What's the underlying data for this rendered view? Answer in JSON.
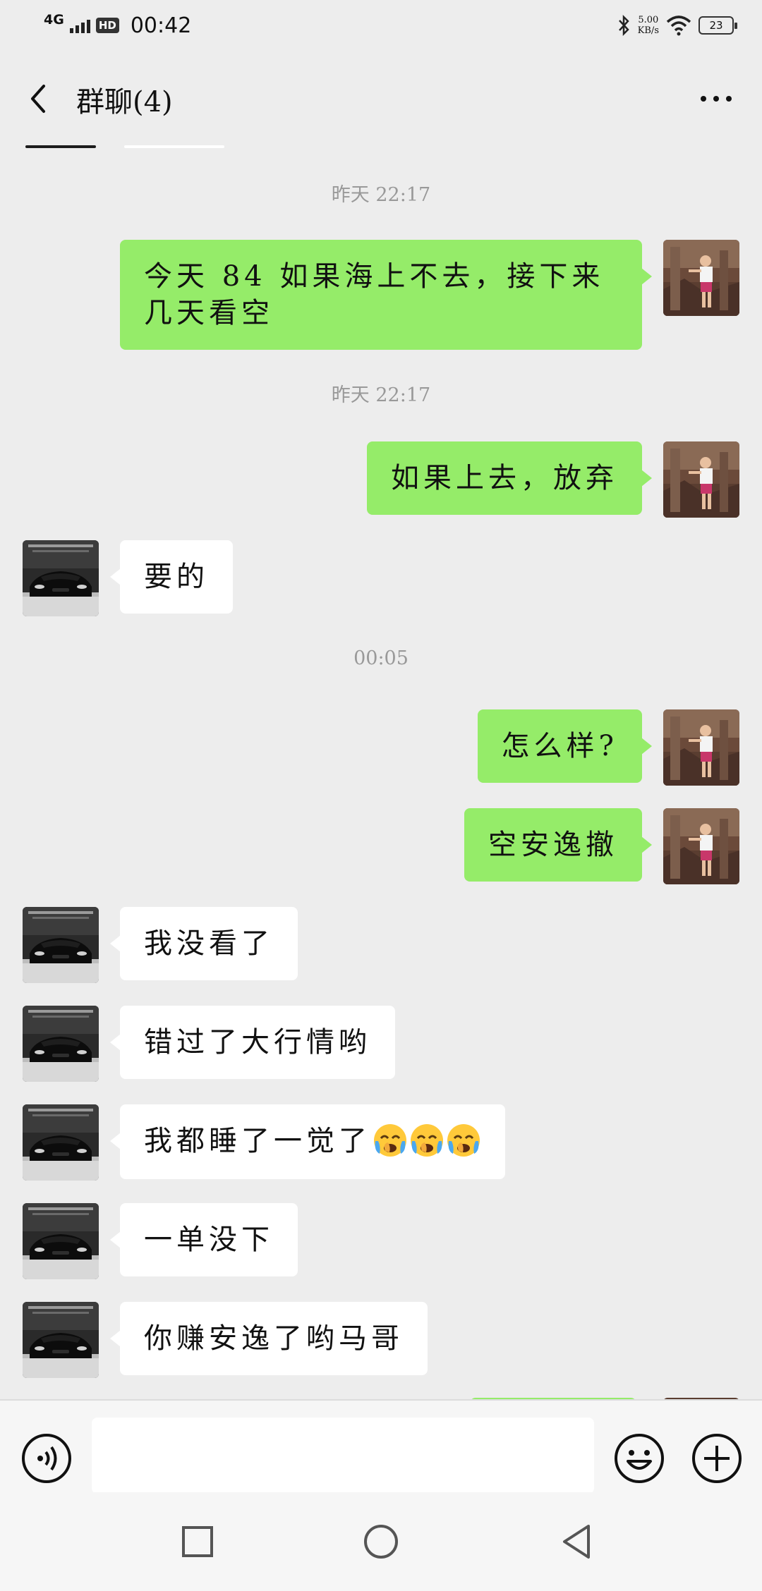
{
  "status_bar": {
    "network": "4G",
    "hd": "HD",
    "time": "00:42",
    "speed_value": "5.00",
    "speed_unit": "KB/s",
    "battery": "23"
  },
  "header": {
    "title": "群聊(4)"
  },
  "messages": {
    "t1": "昨天 22:17",
    "m1": "今天 84 如果海上不去，接下来几天看空",
    "t2": "昨天 22:17",
    "m2": "如果上去，放弃",
    "m3": "要的",
    "t3": "00:05",
    "m4": "怎么样?",
    "m5": "空安逸撤",
    "m6": "我没看了",
    "m7": "错过了大行情哟",
    "m8": "我都睡了一觉了",
    "m9": "一单没下",
    "m10": "你赚安逸了哟马哥"
  },
  "input": {
    "placeholder": ""
  },
  "colors": {
    "background": "#ededed",
    "own_bubble": "#95ec69",
    "other_bubble": "#ffffff",
    "timestamp": "#999999"
  },
  "icons": {
    "back": "chevron-left-icon",
    "more": "more-dots-icon",
    "voice": "voice-icon",
    "emoji": "emoji-icon",
    "plus": "plus-icon",
    "recents": "square-nav-icon",
    "home": "circle-nav-icon",
    "back_nav": "triangle-back-nav-icon"
  }
}
